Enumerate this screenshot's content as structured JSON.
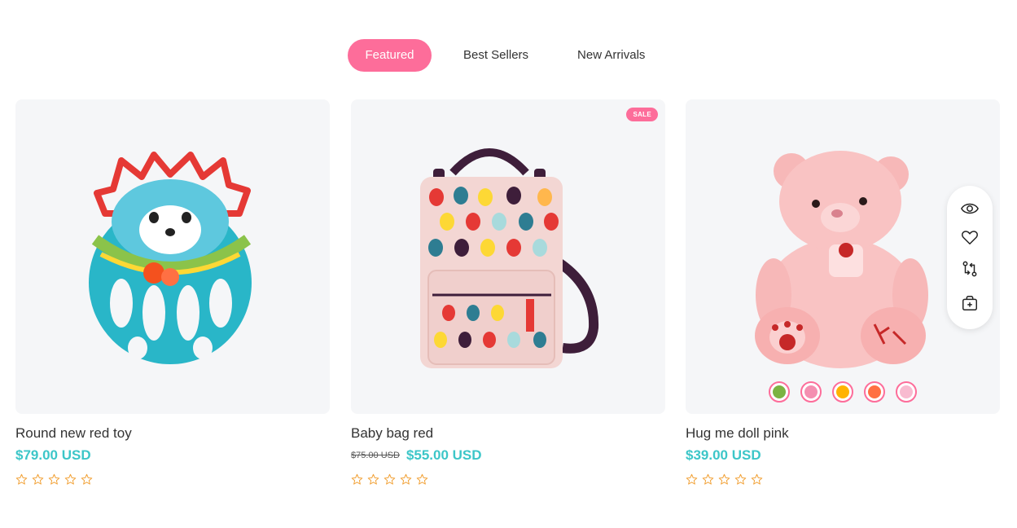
{
  "tabs": [
    {
      "label": "Featured",
      "active": true
    },
    {
      "label": "Best Sellers",
      "active": false
    },
    {
      "label": "New Arrivals",
      "active": false
    }
  ],
  "products": [
    {
      "name": "Round new red toy",
      "price": "$79.00 USD",
      "old_price": "",
      "rating": 0,
      "max_rating": 5,
      "badge": ""
    },
    {
      "name": "Baby bag red",
      "price": "$55.00 USD",
      "old_price": "$75.00 USD",
      "rating": 0,
      "max_rating": 5,
      "badge": "SALE"
    },
    {
      "name": "Hug me doll pink",
      "price": "$39.00 USD",
      "old_price": "",
      "rating": 0,
      "max_rating": 5,
      "badge": "",
      "hover_actions": [
        "eye-icon",
        "heart-icon",
        "compare-icon",
        "add-to-cart-icon"
      ],
      "swatch_colors": [
        "#7cb342",
        "#f48fb1",
        "#ffb300",
        "#ff7043",
        "#f8bbd0"
      ]
    }
  ],
  "colors": {
    "accent": "#fd6d9a",
    "price": "#3cc6c8",
    "star": "#f2a33a",
    "card_bg": "#f5f6f8"
  }
}
